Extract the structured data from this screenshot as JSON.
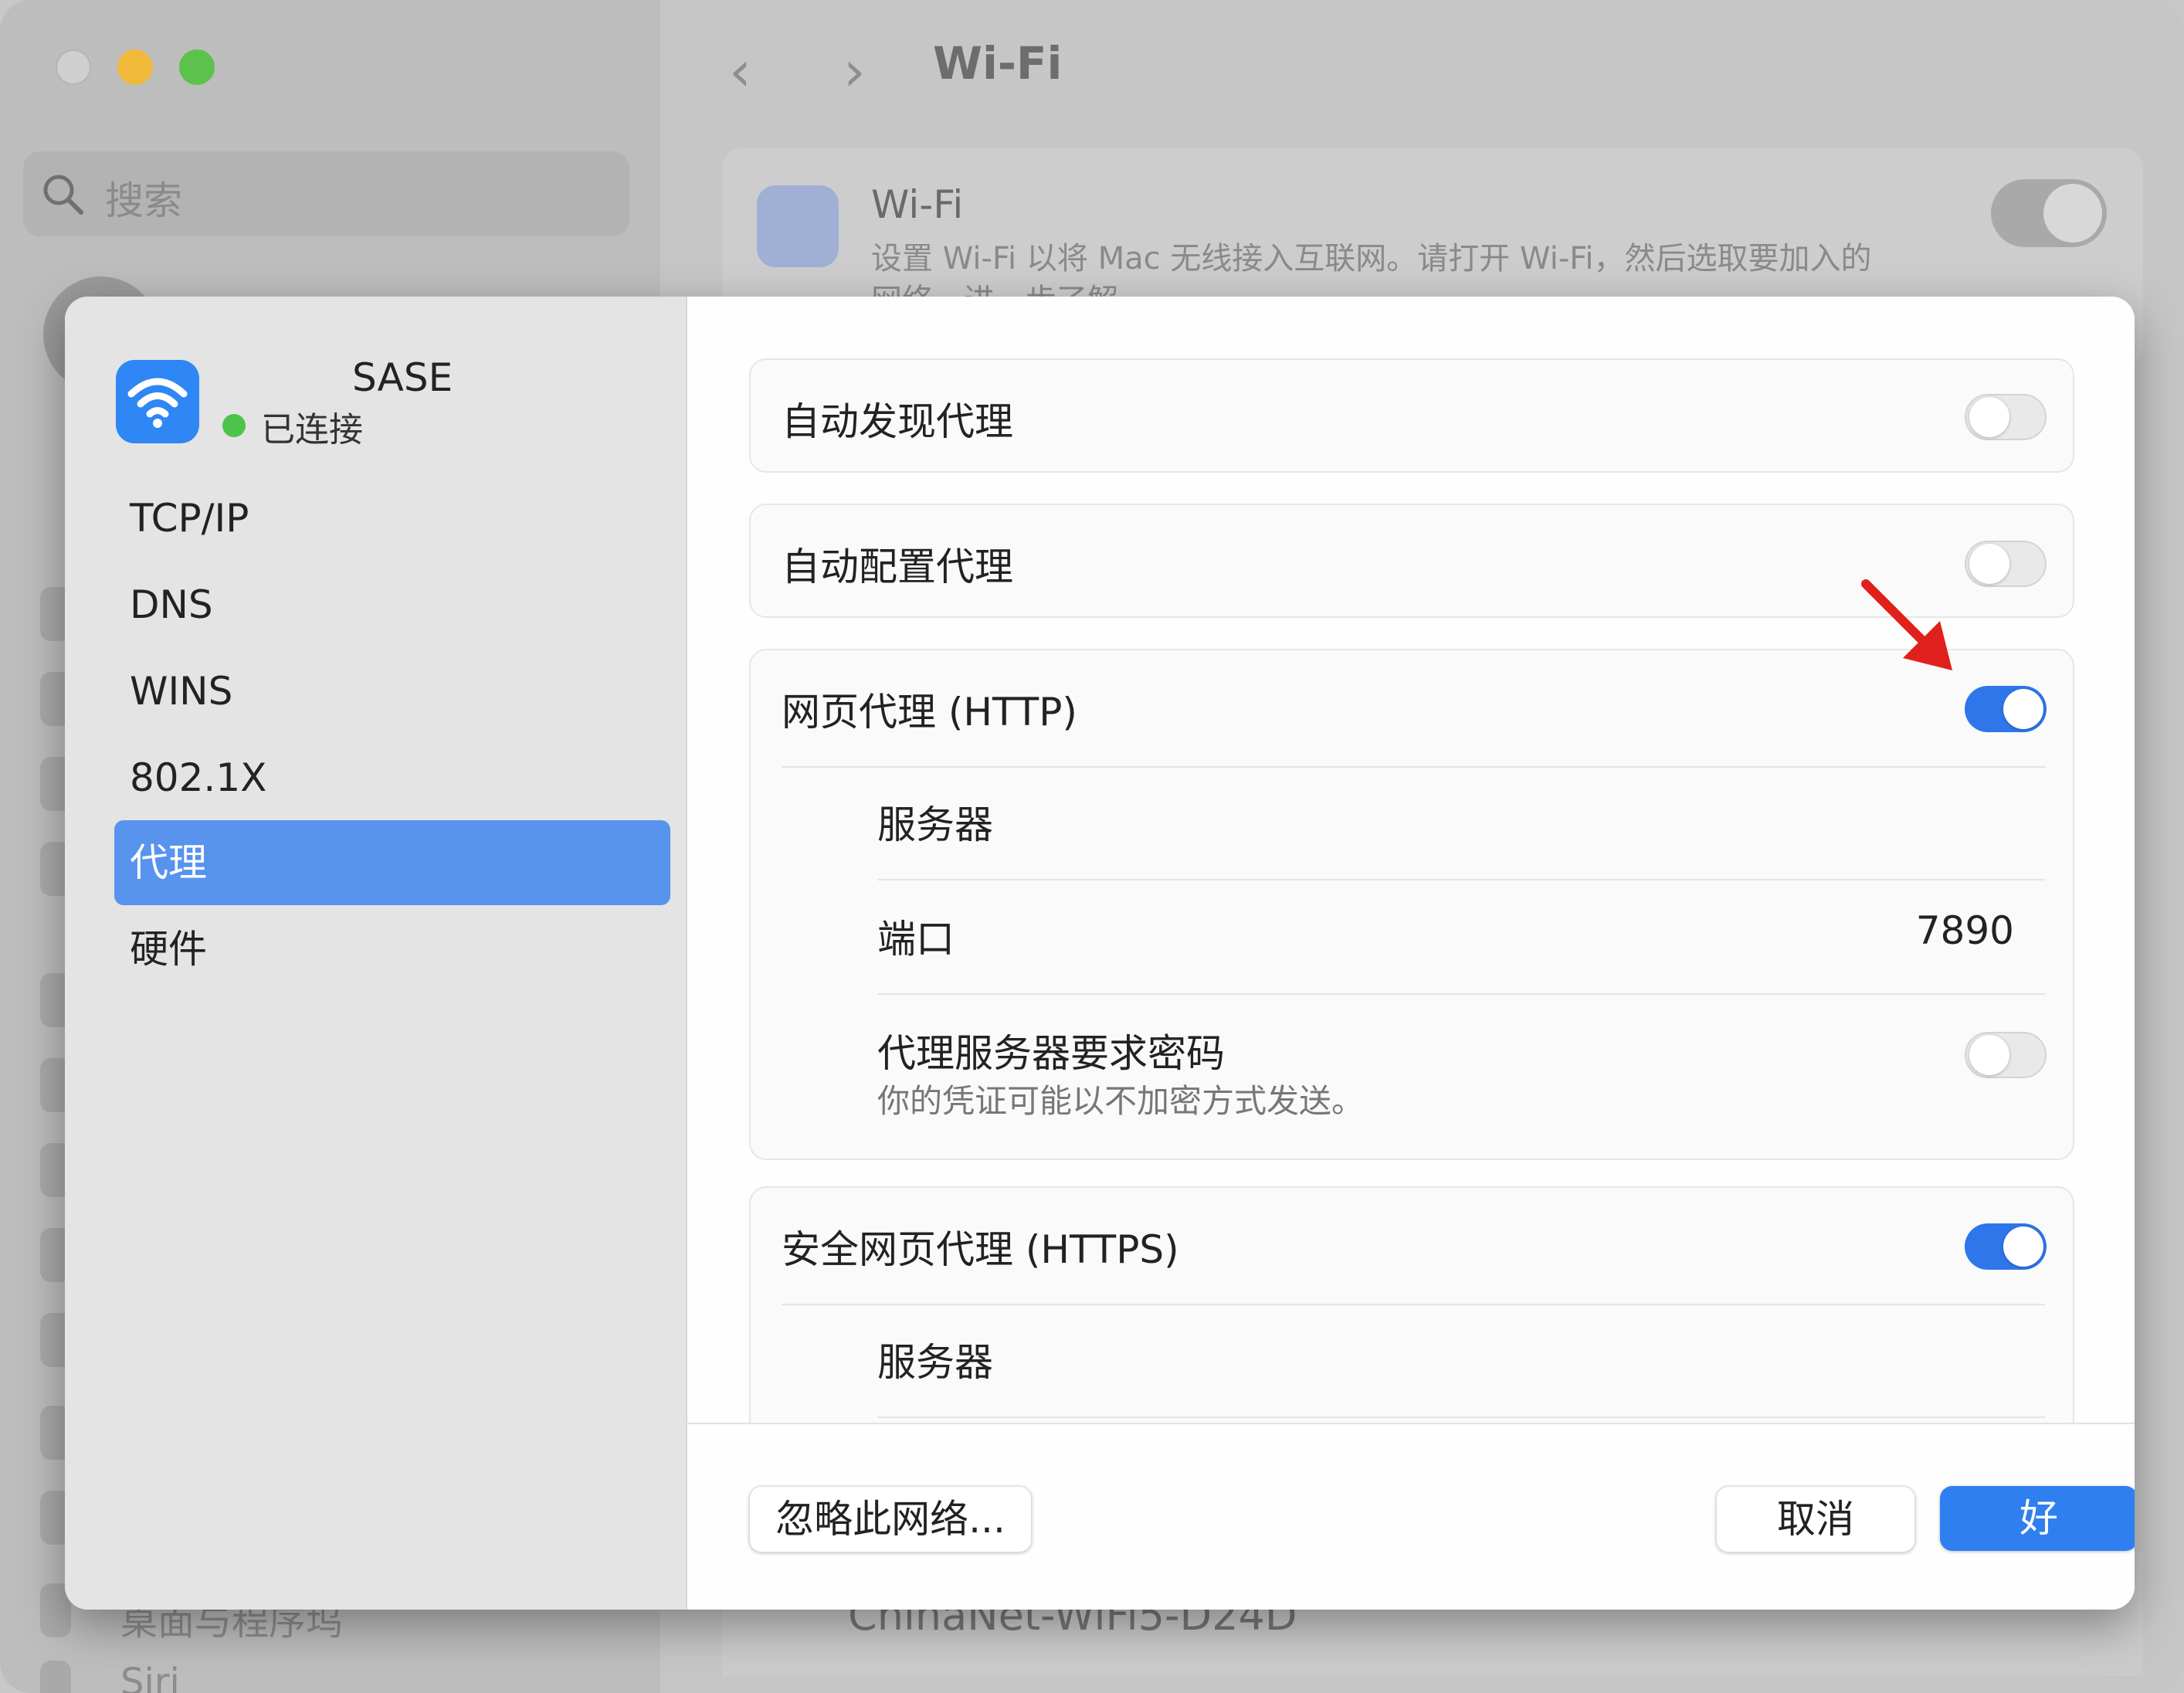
{
  "background": {
    "search_placeholder": "搜索",
    "title": "Wi-Fi",
    "card_title": "Wi-Fi",
    "card_desc": "设置 Wi-Fi 以将 Mac 无线接入互联网。请打开 Wi-Fi，然后选取要加入的",
    "card_desc_2": "网络。进一步了解…",
    "bottom_network": "ChinaNet-WiFi5-D24D",
    "bottom_sidebar_item": "桌面与程序坞",
    "bottom_sidebar_item_2": "Siri"
  },
  "network": {
    "name": "SASE",
    "status": "已连接"
  },
  "sidebar": {
    "items": [
      {
        "label": "TCP/IP",
        "selected": false
      },
      {
        "label": "DNS",
        "selected": false
      },
      {
        "label": "WINS",
        "selected": false
      },
      {
        "label": "802.1X",
        "selected": false
      },
      {
        "label": "代理",
        "selected": true
      },
      {
        "label": "硬件",
        "selected": false
      }
    ]
  },
  "proxies": {
    "auto_discover": {
      "label": "自动发现代理",
      "enabled": false
    },
    "auto_config": {
      "label": "自动配置代理",
      "enabled": false
    },
    "http": {
      "label": "网页代理 (HTTP)",
      "enabled": true,
      "server_label": "服务器",
      "server_value": "",
      "port_label": "端口",
      "port_value": "7890",
      "auth_label": "代理服务器要求密码",
      "auth_enabled": false,
      "auth_hint": "你的凭证可能以不加密方式发送。"
    },
    "https": {
      "label": "安全网页代理 (HTTPS)",
      "enabled": true,
      "server_label": "服务器"
    }
  },
  "footer": {
    "forget_label": "忽略此网络...",
    "cancel_label": "取消",
    "ok_label": "好"
  },
  "colors": {
    "accent": "#2f76ea",
    "selected_sidebar": "#5893ee",
    "connected_dot": "#4cc44a",
    "annotation_arrow": "#e0201c"
  }
}
